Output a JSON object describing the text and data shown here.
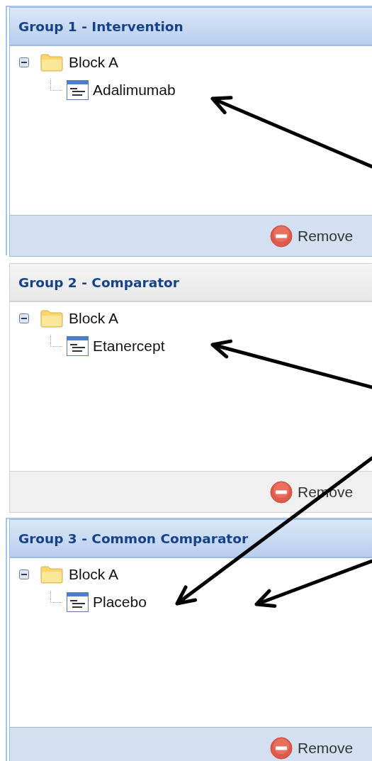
{
  "groups": [
    {
      "title": "Group 1 - Intervention",
      "selected": true,
      "tree": [
        {
          "label": "Block A",
          "expanded": true,
          "children": [
            {
              "label": "Adalimumab"
            }
          ]
        }
      ],
      "footer_button": "Remove"
    },
    {
      "title": "Group 2 - Comparator",
      "selected": false,
      "tree": [
        {
          "label": "Block A",
          "expanded": true,
          "children": [
            {
              "label": "Etanercept"
            }
          ]
        }
      ],
      "footer_button": "Remove"
    },
    {
      "title": "Group 3 - Common Comparator",
      "selected": true,
      "tree": [
        {
          "label": "Block A",
          "expanded": true,
          "children": [
            {
              "label": "Placebo"
            }
          ]
        }
      ],
      "footer_button": "Remove"
    }
  ]
}
